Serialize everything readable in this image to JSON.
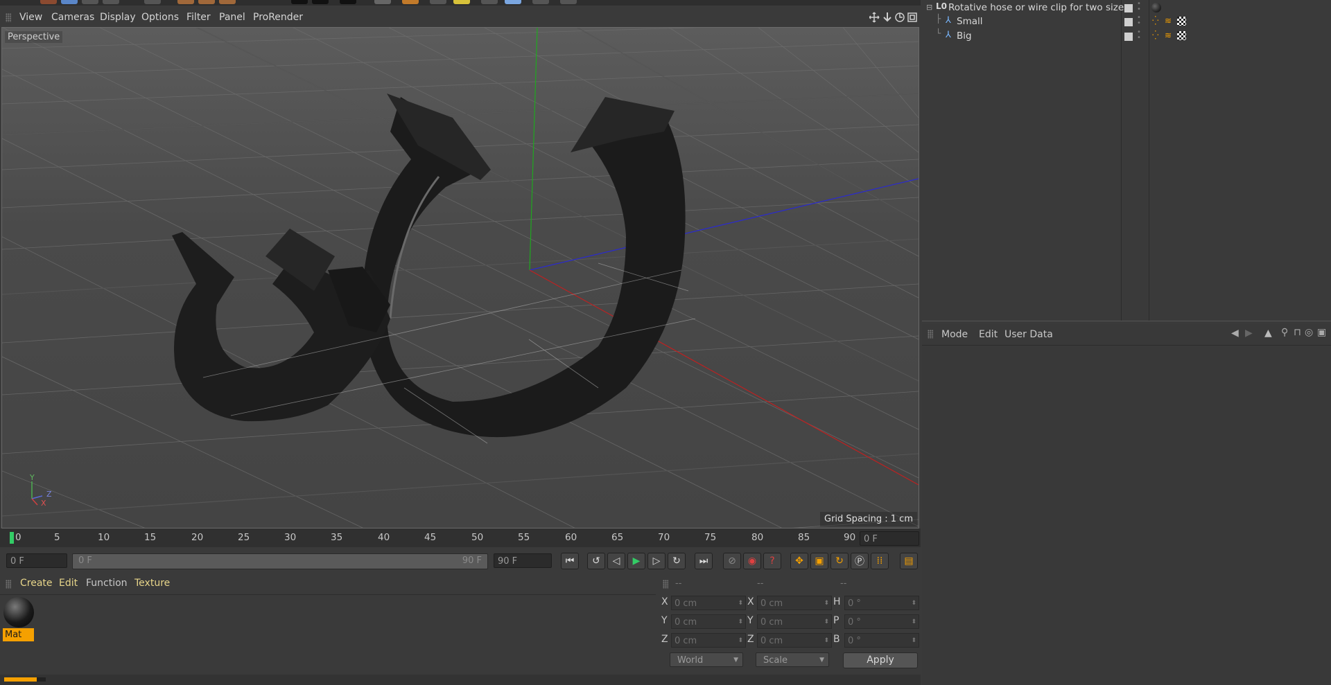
{
  "viewport_menu": [
    "View",
    "Cameras",
    "Display",
    "Options",
    "Filter",
    "Panel",
    "ProRender"
  ],
  "viewport": {
    "camera_label": "Perspective",
    "grid_spacing": "Grid Spacing : 1 cm",
    "axis_labels": {
      "y": "Y",
      "z": "Z",
      "x": "X"
    }
  },
  "object_manager": {
    "rows": [
      {
        "name": "Rotative hose or wire clip for two sizes",
        "icon": "null-object-icon"
      },
      {
        "name": "Small",
        "icon": "polygon-object-icon"
      },
      {
        "name": "Big",
        "icon": "polygon-object-icon"
      }
    ]
  },
  "attribute_manager": {
    "menu": [
      "Mode",
      "Edit",
      "User Data"
    ]
  },
  "timeline": {
    "ticks": [
      "0",
      "5",
      "10",
      "15",
      "20",
      "25",
      "30",
      "35",
      "40",
      "45",
      "50",
      "55",
      "60",
      "65",
      "70",
      "75",
      "80",
      "85",
      "90"
    ],
    "current_frame": "0 F"
  },
  "transport": {
    "start_frame": "0 F",
    "range_start": "0 F",
    "range_end": "90 F",
    "end_frame": "90 F"
  },
  "material_manager": {
    "menu": [
      "Create",
      "Edit",
      "Function",
      "Texture"
    ],
    "materials": [
      {
        "name": "Mat"
      }
    ]
  },
  "coordinates": {
    "headers": [
      "--",
      "--",
      "--"
    ],
    "position": {
      "x": "0 cm",
      "y": "0 cm",
      "z": "0 cm"
    },
    "size": {
      "x": "0 cm",
      "y": "0 cm",
      "z": "0 cm"
    },
    "rotation": {
      "h": "0 °",
      "p": "0 °",
      "b": "0 °"
    },
    "labels": {
      "x": "X",
      "y": "Y",
      "z": "Z",
      "h": "H",
      "p": "P",
      "b": "B"
    },
    "space_select": "World",
    "mode_select": "Scale",
    "apply_label": "Apply"
  },
  "colors": {
    "accent_orange": "#f5a000",
    "menu_yellow": "#e8d68a",
    "timeline_marker": "#33cc66"
  }
}
